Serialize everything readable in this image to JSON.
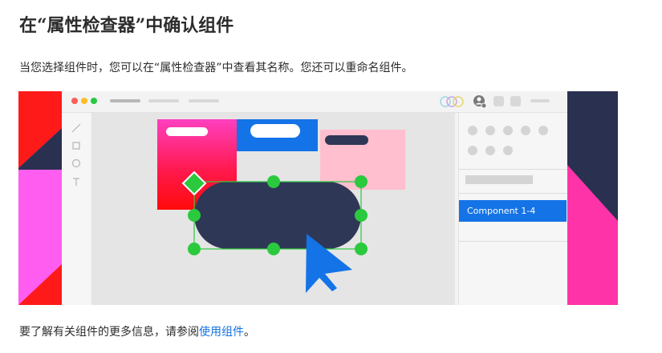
{
  "heading": "在“属性检查器”中确认组件",
  "intro": "当您选择组件时，您可以在“属性检查器”中查看其名称。您还可以重命名组件。",
  "illustration": {
    "component_label": "Component 1-4",
    "colors": {
      "accent": "#1473e6",
      "selection": "#2bc93d",
      "shape_navy": "#2e3756",
      "pink_light": "#ffbfce",
      "magenta": "#ff33a8",
      "red": "#ff1a1a",
      "violet": "#ff5cf0"
    },
    "icons": [
      "line-tool-icon",
      "rectangle-tool-icon",
      "ellipse-tool-icon",
      "text-tool-icon",
      "cursor-icon",
      "avatar-icon"
    ]
  },
  "footer": {
    "text_before": "要了解有关组件的更多信息，请参阅",
    "link": "使用组件",
    "text_after": "。"
  }
}
